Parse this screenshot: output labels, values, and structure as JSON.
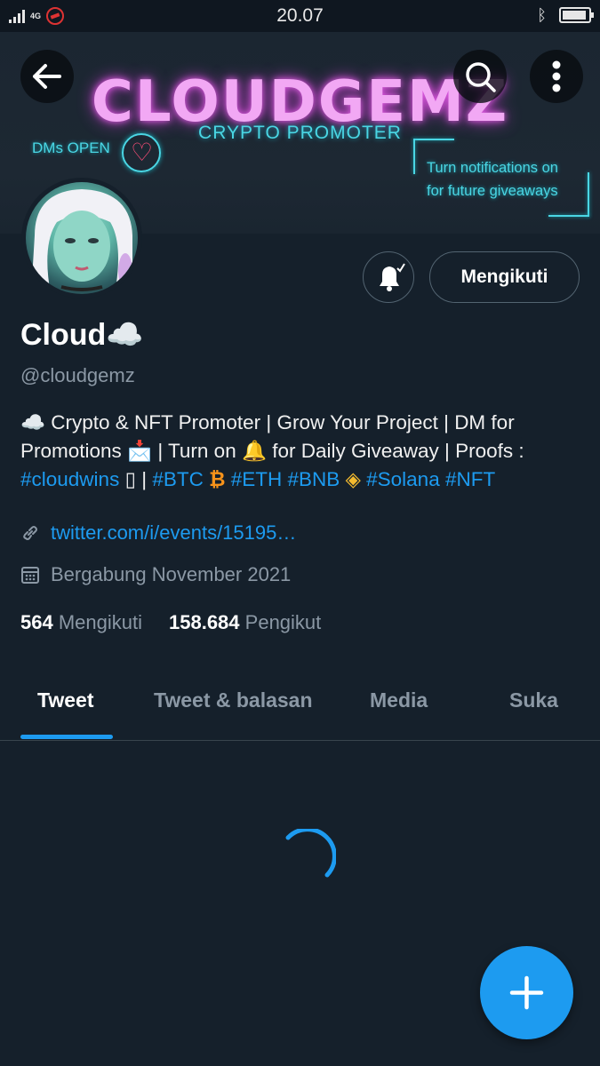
{
  "status_bar": {
    "network": "4G",
    "time": "20.07",
    "bluetooth_icon": "bluetooth-icon",
    "battery_icon": "battery-icon"
  },
  "header": {
    "back_icon": "arrow-left-icon",
    "search_icon": "search-icon",
    "more_icon": "more-vertical-icon"
  },
  "banner": {
    "title": "CLOUDGEMZ",
    "subtitle": "CRYPTO PROMOTER",
    "dms_open": "DMs OPEN",
    "notif_line1": "Turn notifications on",
    "notif_line2": "for future giveaways"
  },
  "profile": {
    "display_name": "Cloud☁️",
    "handle": "@cloudgemz",
    "bio_line1": "☁️ Crypto & NFT Promoter | Grow Your Project | DM for",
    "bio_line2": "Promotions 📩 | Turn on 🔔 for Daily Giveaway | Proofs :",
    "bio_tag_cloudwins": "#cloudwins",
    "bio_box": "▯",
    "bio_sep": " | ",
    "bio_tag_btc": "#BTC",
    "bio_btc_emoji": "₿",
    "bio_tag_eth": "#ETH",
    "bio_tag_bnb": "#BNB",
    "bio_bnb_emoji": "◈",
    "bio_tag_solana": "#Solana",
    "bio_tag_nft": "#NFT",
    "link": "twitter.com/i/events/15195…",
    "joined": "Bergabung November 2021",
    "following_count": "564",
    "following_label": "Mengikuti",
    "followers_count": "158.684",
    "followers_label": "Pengikut"
  },
  "actions": {
    "bell_icon": "bell-checked-icon",
    "follow_label": "Mengikuti"
  },
  "tabs": [
    {
      "label": "Tweet",
      "active": true
    },
    {
      "label": "Tweet & balasan",
      "active": false
    },
    {
      "label": "Media",
      "active": false
    },
    {
      "label": "Suka",
      "active": false
    }
  ],
  "fab": {
    "icon": "plus-icon"
  },
  "colors": {
    "background": "#15202b",
    "accent": "#1d9bf0",
    "muted": "#8b98a5",
    "banner_pink": "#f2a8f4",
    "banner_cyan": "#4ad6e4"
  }
}
